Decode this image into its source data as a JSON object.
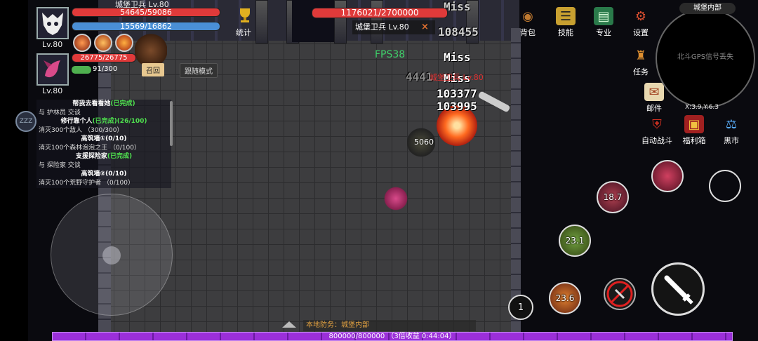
{
  "player": {
    "name_label": "城堡卫兵 Lv.80",
    "hp": "54645/59086",
    "mp": "15569/16862",
    "level": "Lv.80"
  },
  "pet": {
    "hp": "26775/26775",
    "xp": "91/300",
    "level": "Lv.80",
    "summon_label": "召回",
    "follow_label": "跟随模式"
  },
  "stats_label": "统计",
  "target": {
    "hp": "1176021/2700000",
    "name": "城堡卫兵 Lv.80",
    "close": "×"
  },
  "fps": "FPS38",
  "combat_text": {
    "miss1": "Miss",
    "miss2": "Miss",
    "miss3": "Miss",
    "dmg1": "108455",
    "dmg2": "103377",
    "dmg3": "103995",
    "dmg4": "4441",
    "player_dmg": "5060",
    "enemy_tag": "城堡卫兵 Lv.80"
  },
  "quests": [
    {
      "title": "帮我去看看她",
      "status": "(已完成)",
      "desc": "与 护林员 交谈"
    },
    {
      "title": "修行靠个人",
      "status": "(已完成)(26/100)",
      "desc": "消灭300个敌人 （300/300）"
    },
    {
      "title": "高筑墙①(0/10)",
      "status": "",
      "desc": "消灭100个森林泡泡之王 （0/100）"
    },
    {
      "title": "支援探险家",
      "status": "(已完成)",
      "desc": "与 探险家 交谈"
    },
    {
      "title": "高筑墙②(0/10)",
      "status": "",
      "desc": "消灭100个荒野守护者 （0/100）"
    }
  ],
  "sleep_badge": "ZZZ",
  "menu": {
    "bag": "背包",
    "skills": "技能",
    "profession": "专业",
    "settings": "设置",
    "tasks": "任务",
    "mail": "邮件",
    "auto_battle": "自动战斗",
    "welfare": "福利箱",
    "market": "黑市"
  },
  "minimap": {
    "title": "城堡内部",
    "gps": "北斗GPS信号丢失",
    "coords": "X:3.9,Y:6.3"
  },
  "skills": {
    "s1_cd": "18.7",
    "s2_cd": "23.1",
    "s3_cd": "23.6",
    "page": "1"
  },
  "defense": "本地防务：城堡内部",
  "xp": "800000/800000 （3倍收益 0:44:04）",
  "colors": {
    "hp": "#e03a3a",
    "mp": "#4a8fd6",
    "xp": "#9b2fd9",
    "quest_done": "#4fe04f"
  }
}
